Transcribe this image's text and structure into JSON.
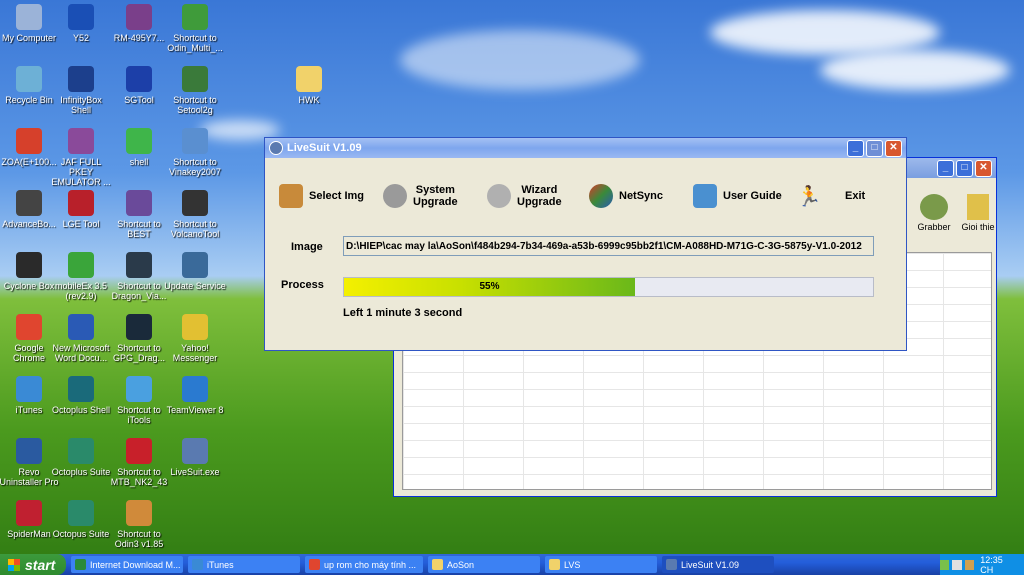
{
  "desktop": {
    "icons": [
      {
        "label": "My Computer",
        "color": "#9bb3d8"
      },
      {
        "label": "Y52",
        "color": "#1a4fb5"
      },
      {
        "label": "RM-495Y7...",
        "color": "#7a3f8a"
      },
      {
        "label": "Shortcut to Odin_Multi_...",
        "color": "#3f9b3a"
      },
      {
        "label": "Recycle Bin",
        "color": "#6db0d6"
      },
      {
        "label": "InfinityBox Shell",
        "color": "#1c3f8c"
      },
      {
        "label": "SGTool",
        "color": "#1c3fa8"
      },
      {
        "label": "Shortcut to Setool2g",
        "color": "#3a7a3a"
      },
      {
        "label": "HWK",
        "color": "#f1d26a"
      },
      {
        "label": "ZOA(E+100...",
        "color": "#d6402b"
      },
      {
        "label": "JAF FULL PKEY EMULATOR ...",
        "color": "#8a4a9a"
      },
      {
        "label": "shell",
        "color": "#3fb54a"
      },
      {
        "label": "Shortcut to Vinakey2007",
        "color": "#5a8fd0"
      },
      {
        "label": "AdvanceBo...",
        "color": "#444444"
      },
      {
        "label": "LGE Tool",
        "color": "#b8202a"
      },
      {
        "label": "Shortcut to BEST",
        "color": "#6a4a9a"
      },
      {
        "label": "Shortcut to VolcanoTool",
        "color": "#333333"
      },
      {
        "label": "Cyclone Box",
        "color": "#2a2a2a"
      },
      {
        "label": "mobileEx 3.5 (rev2.9)",
        "color": "#3aa53a"
      },
      {
        "label": "Shortcut to Dragon_Via...",
        "color": "#2a3a4a"
      },
      {
        "label": "Update Service",
        "color": "#3a6a9a"
      },
      {
        "label": "Google Chrome",
        "color": "#e0452f"
      },
      {
        "label": "New Microsoft Word Docu...",
        "color": "#2a5ab5"
      },
      {
        "label": "Shortcut to GPG_Drag...",
        "color": "#1a2a3a"
      },
      {
        "label": "Yahoo! Messenger",
        "color": "#e2c032"
      },
      {
        "label": "iTunes",
        "color": "#3a8ad5"
      },
      {
        "label": "Octoplus Shell",
        "color": "#1a6a7a"
      },
      {
        "label": "Shortcut to iTools",
        "color": "#4aa0e0"
      },
      {
        "label": "TeamViewer 8",
        "color": "#2a7ad0"
      },
      {
        "label": "Revo Uninstaller Pro",
        "color": "#2a5aa0"
      },
      {
        "label": "Octoplus Suite",
        "color": "#2a8a6a"
      },
      {
        "label": "Shortcut to MTB_NK2_43",
        "color": "#c8202a"
      },
      {
        "label": "LiveSuit.exe",
        "color": "#5a7ab0"
      },
      {
        "label": "SpiderMan",
        "color": "#c02030"
      },
      {
        "label": "Octopus Suite",
        "color": "#2a8a6a"
      },
      {
        "label": "Shortcut to Odin3 v1.85",
        "color": "#d08a3a"
      }
    ]
  },
  "back_window": {
    "toolbar": [
      {
        "label": "Grabber",
        "icon": "grabber-icon"
      },
      {
        "label": "Gioi thie",
        "icon": "info-icon"
      }
    ]
  },
  "livesuit": {
    "title": "LiveSuit V1.09",
    "toolbar": {
      "select_img": "Select Img",
      "system_upgrade": "System\nUpgrade",
      "system_upgrade_l1": "System",
      "system_upgrade_l2": "Upgrade",
      "wizard_upgrade_l1": "Wizard",
      "wizard_upgrade_l2": "Upgrade",
      "netsync": "NetSync",
      "user_guide": "User Guide",
      "exit": "Exit"
    },
    "image_label": "Image",
    "image_path": "D:\\HIEP\\cac may la\\AoSon\\f484b294-7b34-469a-a53b-6999c95bb2f1\\CM-A088HD-M71G-C-3G-5875y-V1.0-2012",
    "process_label": "Process",
    "progress_percent": 55,
    "progress_text": "55%",
    "remaining_text": "Left 1 minute 3 second",
    "accent": "#a6d22e"
  },
  "taskbar": {
    "start_label": "start",
    "tasks": [
      {
        "label": "Internet Download M...",
        "color": "#2a8a3a",
        "active": false
      },
      {
        "label": "iTunes",
        "color": "#3a8ad5",
        "active": false
      },
      {
        "label": "up rom cho máy tính ...",
        "color": "#e0452f",
        "active": false
      },
      {
        "label": "AoSon",
        "color": "#f1d26a",
        "active": false
      },
      {
        "label": "LVS",
        "color": "#f1d26a",
        "active": false
      },
      {
        "label": "LiveSuit V1.09",
        "color": "#5a7ab0",
        "active": true
      }
    ],
    "clock": "12:35 CH"
  }
}
